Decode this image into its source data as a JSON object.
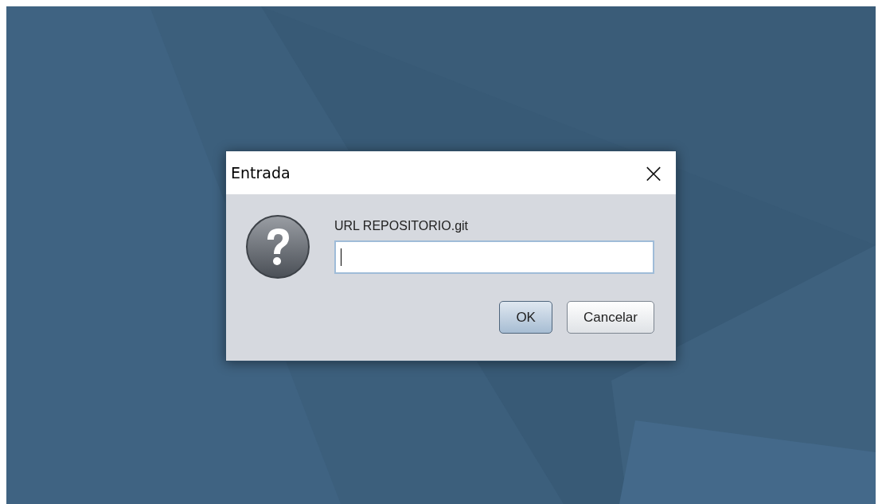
{
  "dialog": {
    "title": "Entrada",
    "close": "×",
    "prompt": "URL REPOSITORIO.git",
    "field": {
      "focused": true
    },
    "buttons": [
      {
        "label": "OK",
        "default": true
      },
      {
        "label": "Cancelar",
        "default": false
      }
    ]
  }
}
